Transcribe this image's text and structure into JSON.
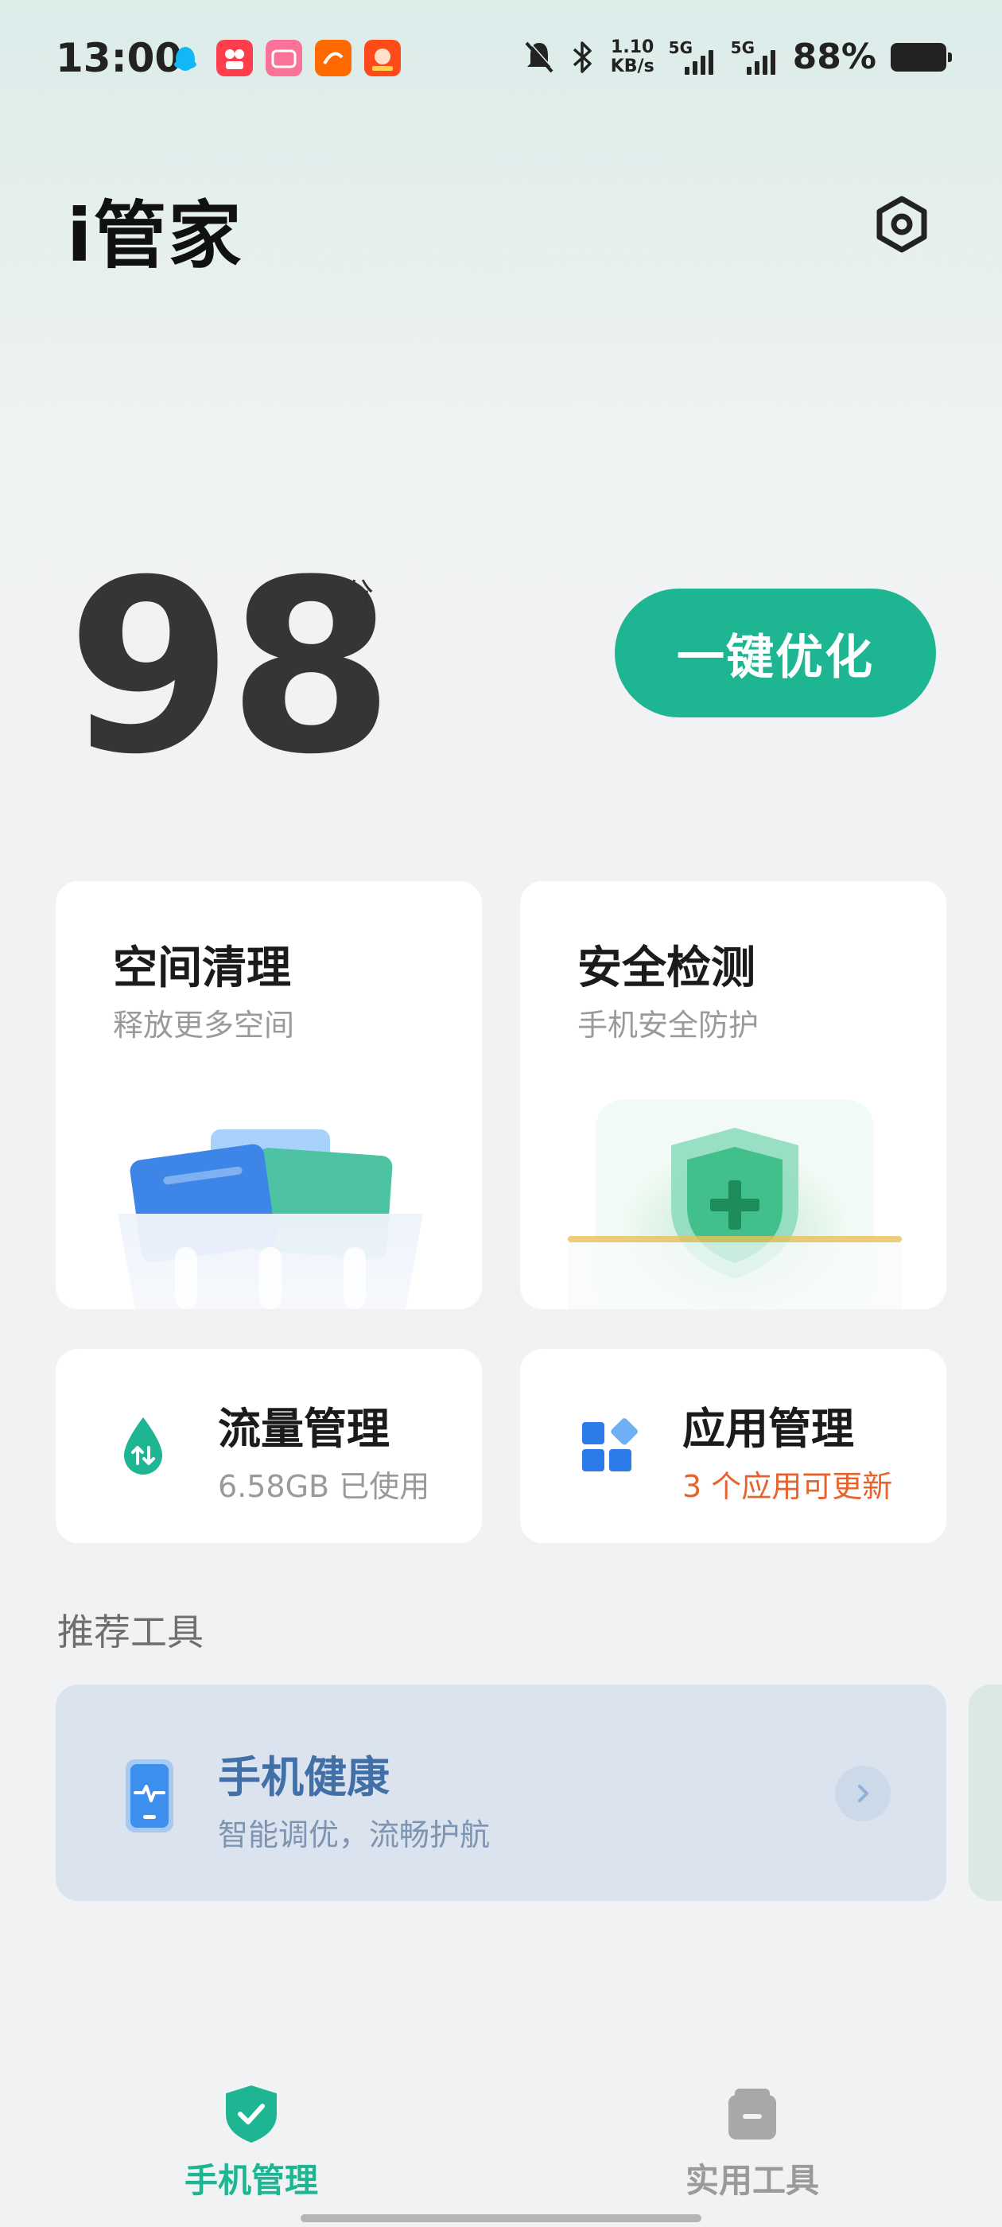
{
  "status_bar": {
    "time": "13:00",
    "net_speed_value": "1.10",
    "net_speed_unit": "KB/s",
    "sim1": "5G",
    "sim2": "5G",
    "battery_percent": "88%",
    "icons": [
      "qq-icon",
      "kuaishou-icon",
      "bilibili-icon",
      "1688-icon",
      "taobao-icon",
      "mute-icon",
      "bluetooth-icon",
      "signal-icon",
      "battery-icon"
    ]
  },
  "header": {
    "title": "i管家",
    "settings_icon": "settings-hex-icon"
  },
  "score": {
    "value": "98",
    "unit": "分",
    "optimize_button": "一键优化"
  },
  "cards": {
    "space_clean": {
      "title": "空间清理",
      "subtitle": "释放更多空间"
    },
    "security": {
      "title": "安全检测",
      "subtitle": "手机安全防护"
    },
    "traffic": {
      "title": "流量管理",
      "subtitle": "6.58GB 已使用"
    },
    "apps": {
      "title": "应用管理",
      "subtitle": "3 个应用可更新"
    }
  },
  "recommended": {
    "section_title": "推荐工具",
    "tools": [
      {
        "title": "手机健康",
        "subtitle": "智能调优，流畅护航"
      }
    ]
  },
  "bottom_nav": {
    "items": [
      {
        "label": "手机管理",
        "active": true
      },
      {
        "label": "实用工具",
        "active": false
      }
    ]
  },
  "colors": {
    "accent": "#1db592",
    "alert": "#e8622c",
    "tool_title": "#4170a8"
  }
}
